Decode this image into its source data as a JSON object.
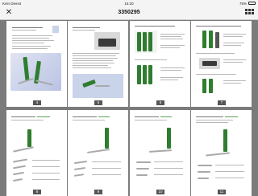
{
  "status_bar": {
    "carrier": "Kein Dienst",
    "time": "15:20",
    "battery": "75%"
  },
  "nav": {
    "title": "3350295"
  },
  "page_numbers": [
    "4",
    "5",
    "6",
    "7",
    "8",
    "9",
    "10",
    "11"
  ]
}
